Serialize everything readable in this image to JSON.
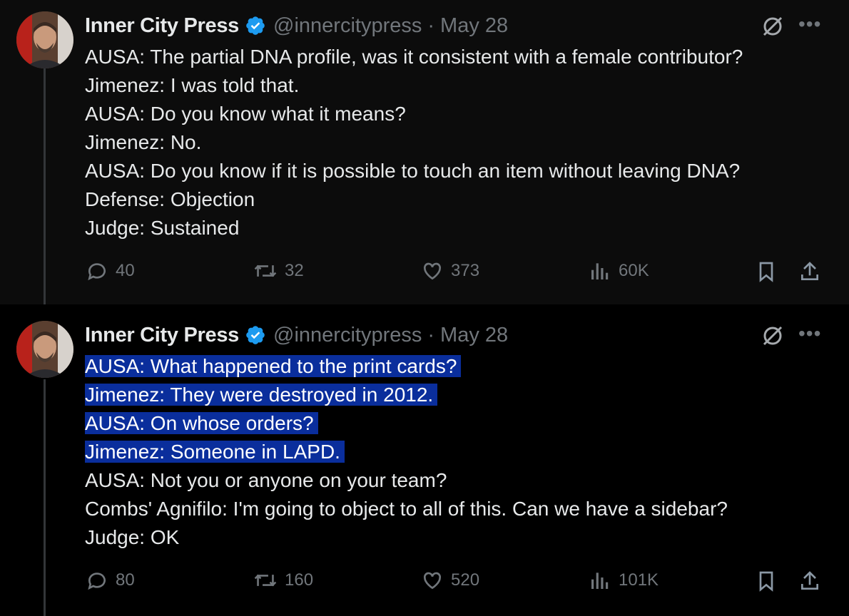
{
  "tweets": [
    {
      "author": {
        "name": "Inner City Press",
        "handle": "@innercitypress"
      },
      "date": "May 28",
      "lines": [
        "AUSA: The partial DNA profile, was it consistent with a female contributor?",
        "Jimenez: I was told that.",
        "AUSA: Do you know what it means?",
        "Jimenez: No.",
        "AUSA: Do you know if it is possible to touch an item without leaving DNA?",
        "Defense: Objection",
        "Judge: Sustained"
      ],
      "highlighted_lines": [],
      "stats": {
        "replies": "40",
        "reposts": "32",
        "likes": "373",
        "views": "60K"
      }
    },
    {
      "author": {
        "name": "Inner City Press",
        "handle": "@innercitypress"
      },
      "date": "May 28",
      "lines": [
        "AUSA: What happened to the print cards?",
        "Jimenez: They were destroyed in 2012.",
        "AUSA: On whose orders?",
        "Jimenez: Someone in LAPD.",
        "AUSA: Not you or anyone on your team?",
        "Combs' Agnifilo: I'm going to object to all of this. Can we have a sidebar?",
        "Judge: OK"
      ],
      "highlighted_lines": [
        0,
        1,
        2,
        3
      ],
      "stats": {
        "replies": "80",
        "reposts": "160",
        "likes": "520",
        "views": "101K"
      }
    }
  ],
  "colors": {
    "text": "#e7e9ea",
    "muted": "#71767b",
    "verified": "#1d9bf0",
    "selection": "#0a2e9c"
  },
  "icons": [
    "verified-badge-icon",
    "grok-icon",
    "more-icon",
    "reply-icon",
    "repost-icon",
    "like-icon",
    "views-icon",
    "bookmark-icon",
    "share-icon"
  ]
}
